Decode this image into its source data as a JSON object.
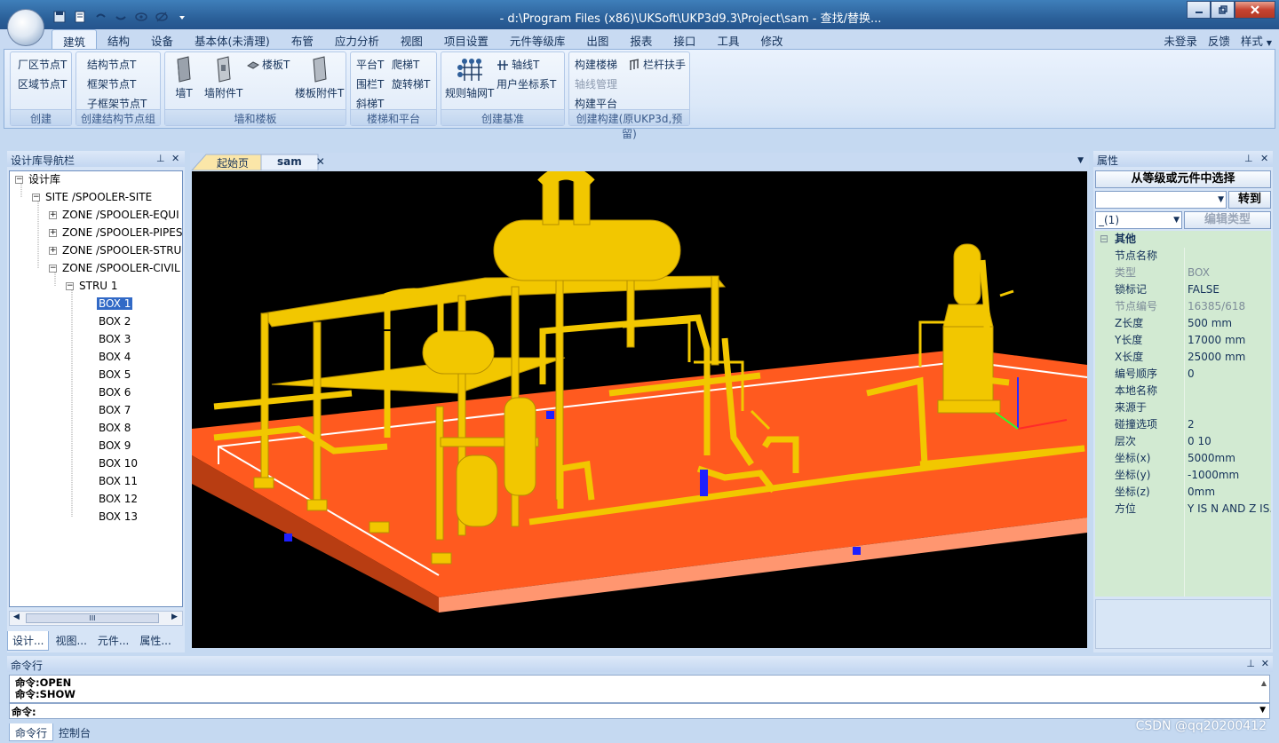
{
  "window": {
    "title": "- d:\\Program Files (x86)\\UKSoft\\UKP3d9.3\\Project\\sam - 查找/替换..."
  },
  "ribbon_tabs": [
    "建筑",
    "结构",
    "设备",
    "基本体(未清理)",
    "布管",
    "应力分析",
    "视图",
    "项目设置",
    "元件等级库",
    "出图",
    "报表",
    "接口",
    "工具",
    "修改"
  ],
  "right_links": [
    "未登录",
    "反馈",
    "样式"
  ],
  "groups": {
    "create": {
      "label": "创建",
      "buttons": [
        "厂区节点T",
        "区域节点T"
      ]
    },
    "struct_nodes": {
      "label": "创建结构节点组",
      "buttons": [
        "结构节点T",
        "框架节点T",
        "子框架节点T"
      ]
    },
    "walls": {
      "label": "墙和楼板",
      "wall": "墙T",
      "wall_attach": "墙附件T",
      "slab": "楼板T",
      "slab_attach": "楼板附件T"
    },
    "stairs": {
      "label": "楼梯和平台",
      "buttons": [
        "平台T",
        "爬梯T",
        "围栏T",
        "旋转梯T",
        "斜梯T"
      ]
    },
    "datum": {
      "label": "创建基准",
      "grid": "规则轴网T",
      "axis": "轴线T",
      "ucs": "用户坐标系T"
    },
    "build": {
      "label": "创建构建(原UKP3d,预留)",
      "stairs": "构建楼梯",
      "rail": "栏杆扶手",
      "axis_mgmt": "轴线管理",
      "platform": "构建平台"
    }
  },
  "nav_panel": {
    "title": "设计库导航栏",
    "tree": [
      {
        "label": "设计库",
        "level": 0,
        "expander": "−"
      },
      {
        "label": "SITE /SPOOLER-SITE",
        "level": 1,
        "expander": "−"
      },
      {
        "label": "ZONE /SPOOLER-EQUI",
        "level": 2,
        "expander": "+"
      },
      {
        "label": "ZONE /SPOOLER-PIPES",
        "level": 2,
        "expander": "+"
      },
      {
        "label": "ZONE /SPOOLER-STRU",
        "level": 2,
        "expander": "+"
      },
      {
        "label": "ZONE /SPOOLER-CIVIL",
        "level": 2,
        "expander": "−"
      },
      {
        "label": "STRU 1",
        "level": 3,
        "expander": "−"
      },
      {
        "label": "BOX 1",
        "level": 4,
        "selected": true
      },
      {
        "label": "BOX 2",
        "level": 4
      },
      {
        "label": "BOX 3",
        "level": 4
      },
      {
        "label": "BOX 4",
        "level": 4
      },
      {
        "label": "BOX 5",
        "level": 4
      },
      {
        "label": "BOX 6",
        "level": 4
      },
      {
        "label": "BOX 7",
        "level": 4
      },
      {
        "label": "BOX 8",
        "level": 4
      },
      {
        "label": "BOX 9",
        "level": 4
      },
      {
        "label": "BOX 10",
        "level": 4
      },
      {
        "label": "BOX 11",
        "level": 4
      },
      {
        "label": "BOX 12",
        "level": 4
      },
      {
        "label": "BOX 13",
        "level": 4
      }
    ],
    "scroll_thumb": "III",
    "tabs": [
      "设计...",
      "视图...",
      "元件...",
      "属性..."
    ]
  },
  "doc_tabs": [
    "起始页",
    "sam"
  ],
  "properties": {
    "title": "属性",
    "select_button": "从等级或元件中选择",
    "goto_button": "转到",
    "type_combo": "_(1)",
    "edit_type_button": "编辑类型",
    "category": "其他",
    "rows": [
      {
        "k": "节点名称",
        "v": ""
      },
      {
        "k": "类型",
        "v": "BOX",
        "dim": true
      },
      {
        "k": "锁标记",
        "v": "FALSE"
      },
      {
        "k": "节点编号",
        "v": "16385/618",
        "dim": true
      },
      {
        "k": "Z长度",
        "v": "500 mm"
      },
      {
        "k": "Y长度",
        "v": "17000 mm"
      },
      {
        "k": "X长度",
        "v": "25000 mm"
      },
      {
        "k": "编号顺序",
        "v": "0"
      },
      {
        "k": "本地名称",
        "v": ""
      },
      {
        "k": "来源于",
        "v": ""
      },
      {
        "k": "碰撞选项",
        "v": "2"
      },
      {
        "k": "层次",
        "v": "0 10"
      },
      {
        "k": "坐标(x)",
        "v": " 5000mm"
      },
      {
        "k": "坐标(y)",
        "v": " -1000mm"
      },
      {
        "k": "坐标(z)",
        "v": " 0mm"
      },
      {
        "k": "方位",
        "v": "Y IS N AND Z IS..."
      }
    ]
  },
  "command": {
    "title": "命令行",
    "log": [
      "命令:OPEN",
      "命令:SHOW"
    ],
    "prompt": "命令:",
    "tabs": [
      "命令行",
      "控制台"
    ]
  },
  "watermark": "CSDN @qq20200412",
  "colors": {
    "accent": "#3169c6",
    "floor": "#ff5a1f",
    "equipment": "#f2c700",
    "viewport_bg": "#000000"
  }
}
